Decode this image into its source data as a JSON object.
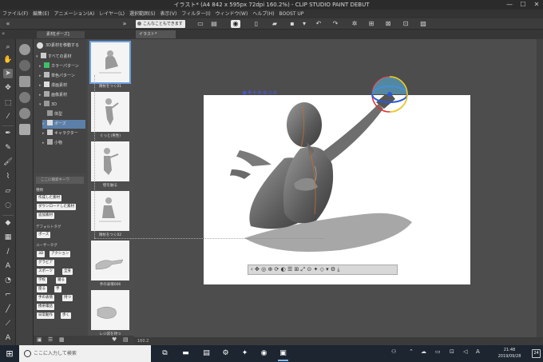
{
  "window": {
    "title": "イラスト* (A4 842 x 595px 72dpi 160.2%) - CLIP STUDIO PAINT DEBUT",
    "minimize": "—",
    "maximize": "☐",
    "close": "✕"
  },
  "menu": [
    "ファイル(F)",
    "編集(E)",
    "アニメーション(A)",
    "レイヤー(L)",
    "選択範囲(S)",
    "表示(V)",
    "フィルター(I)",
    "ウィンドウ(W)",
    "ヘルプ(H)",
    "BOOST UP"
  ],
  "command_bar": {
    "can_do_label": "こんなこともできます"
  },
  "tabs": {
    "panel_tab": "素材[ポーズ]",
    "document_tab": "イラスト*"
  },
  "material": {
    "header": "3D素材を移動する",
    "tree": [
      {
        "label": "すべての素材",
        "depth": 0
      },
      {
        "label": "カラーパターン",
        "depth": 1
      },
      {
        "label": "単色パターン",
        "depth": 1
      },
      {
        "label": "漫画素材",
        "depth": 1
      },
      {
        "label": "画像素材",
        "depth": 1
      },
      {
        "label": "3D",
        "depth": 1
      },
      {
        "label": "体型",
        "depth": 2
      },
      {
        "label": "ポーズ",
        "depth": 2
      },
      {
        "label": "キャラクター",
        "depth": 2
      },
      {
        "label": "小物",
        "depth": 2
      }
    ],
    "search_placeholder": "ここに検索キーワ",
    "section_kind": "種類",
    "kind_tags": [
      "作成した素材",
      "ダウンロードした素材",
      "追加素材"
    ],
    "section_default": "デフォルトタグ",
    "default_tags": [
      "ポーズ"
    ],
    "section_user": "ユーザータグ",
    "user_tags": [
      "3D",
      "アクション",
      "グラビア",
      "スポーツ",
      "全身",
      "学校",
      "寝る",
      "座る",
      "手",
      "手の表情",
      "持つ",
      "携帯電話",
      "日常動作",
      "歩く"
    ],
    "thumbnails": [
      "頬杖をつく01",
      "ぐっと(男性)",
      "壁を触る",
      "頬杖をつく02",
      "手の表情006",
      "レジ袋を持つ"
    ]
  },
  "canvas": {
    "status": "160.2"
  },
  "taskbar": {
    "search_placeholder": "ここに入力して検索",
    "time": "21:48",
    "date": "2019/09/28",
    "notification_count": "24",
    "ime": "A"
  },
  "colors": {
    "accent": "#5b7fa8",
    "gizmo_blue": "#2a5ad8",
    "gizmo_red": "#e03030",
    "gizmo_yellow": "#e8d020"
  }
}
